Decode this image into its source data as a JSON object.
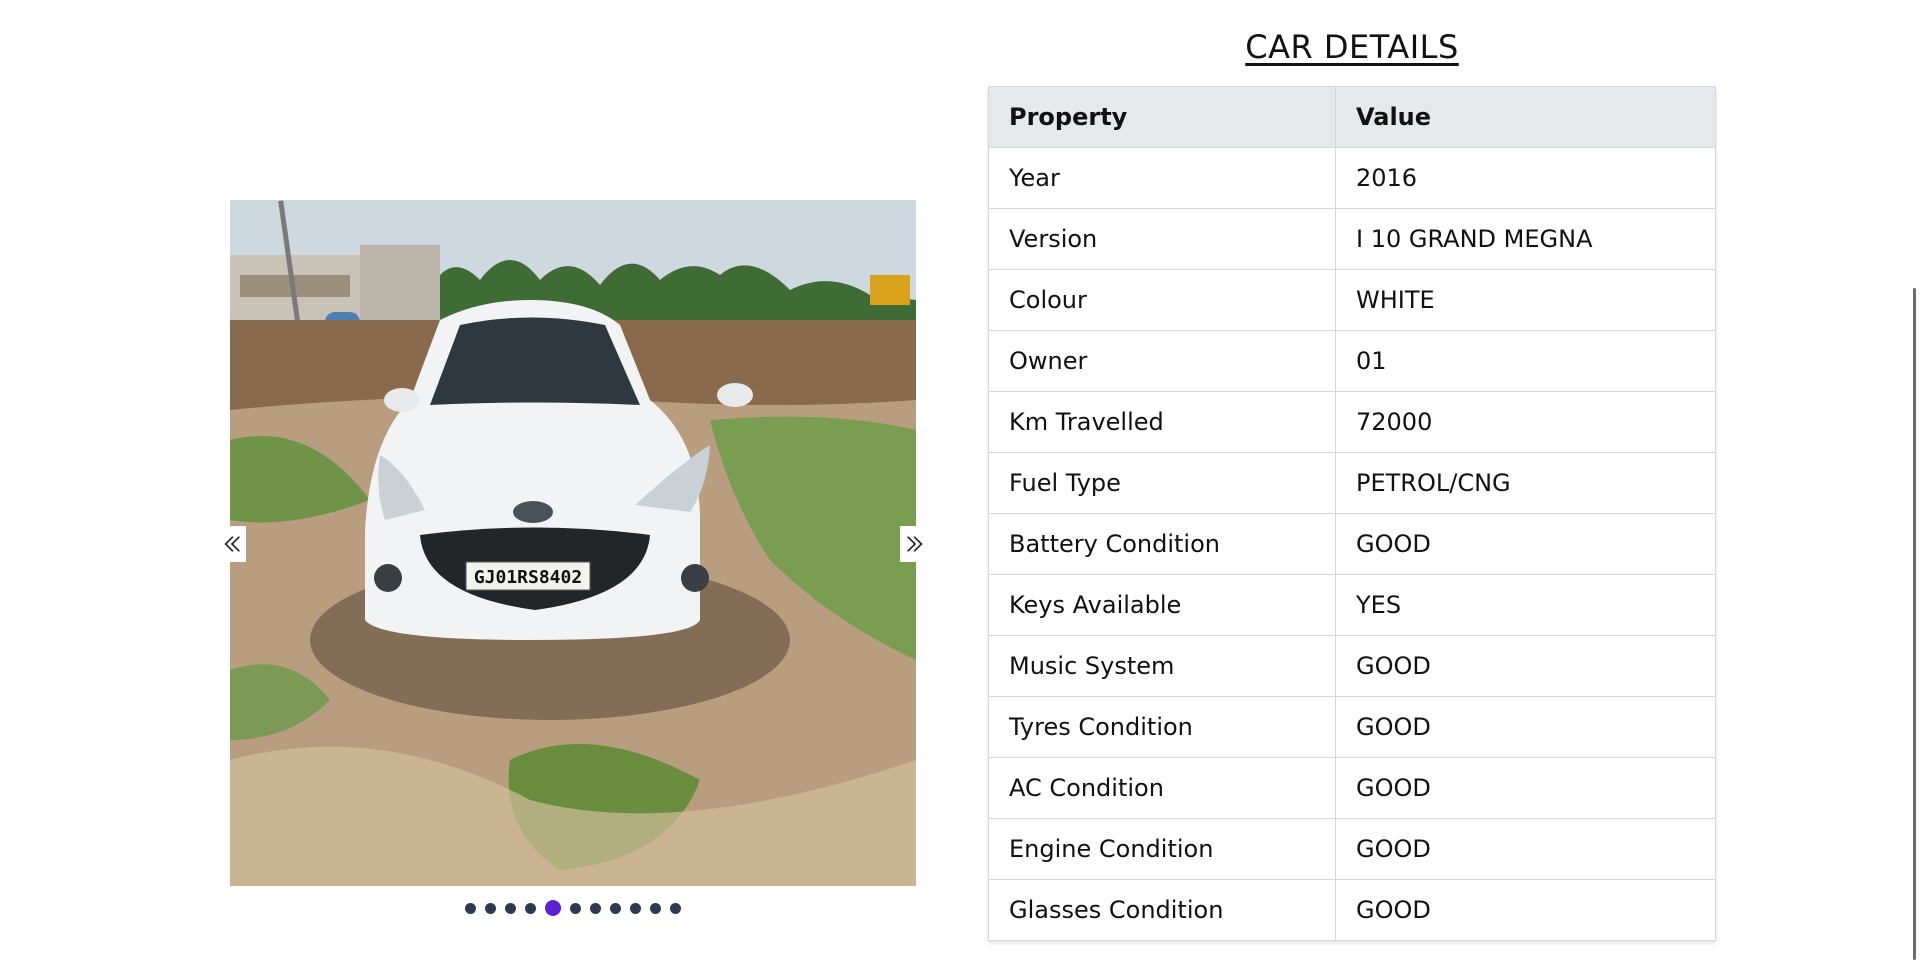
{
  "carousel": {
    "plate_text": "GJ01RS8402",
    "active_index": 4,
    "dots": [
      1,
      2,
      3,
      4,
      5,
      6,
      7,
      8,
      9,
      10,
      11
    ]
  },
  "details": {
    "title": "CAR DETAILS",
    "headers": [
      "Property",
      "Value"
    ],
    "rows": [
      {
        "property": "Year",
        "value": "2016"
      },
      {
        "property": "Version",
        "value": "I 10 GRAND MEGNA"
      },
      {
        "property": "Colour",
        "value": "WHITE"
      },
      {
        "property": "Owner",
        "value": "01"
      },
      {
        "property": "Km Travelled",
        "value": "72000"
      },
      {
        "property": "Fuel Type",
        "value": "PETROL/CNG"
      },
      {
        "property": "Battery Condition",
        "value": "GOOD"
      },
      {
        "property": "Keys Available",
        "value": "YES"
      },
      {
        "property": "Music System",
        "value": "GOOD"
      },
      {
        "property": "Tyres Condition",
        "value": "GOOD"
      },
      {
        "property": "AC Condition",
        "value": "GOOD"
      },
      {
        "property": "Engine Condition",
        "value": "GOOD"
      },
      {
        "property": "Glasses Condition",
        "value": "GOOD"
      }
    ]
  },
  "colors": {
    "active_dot": "#5b21d6",
    "dot": "#2e3a4f",
    "header_bg": "#e6e8ec"
  },
  "icons": {
    "prev": "chevrons-left-icon",
    "next": "chevrons-right-icon"
  }
}
